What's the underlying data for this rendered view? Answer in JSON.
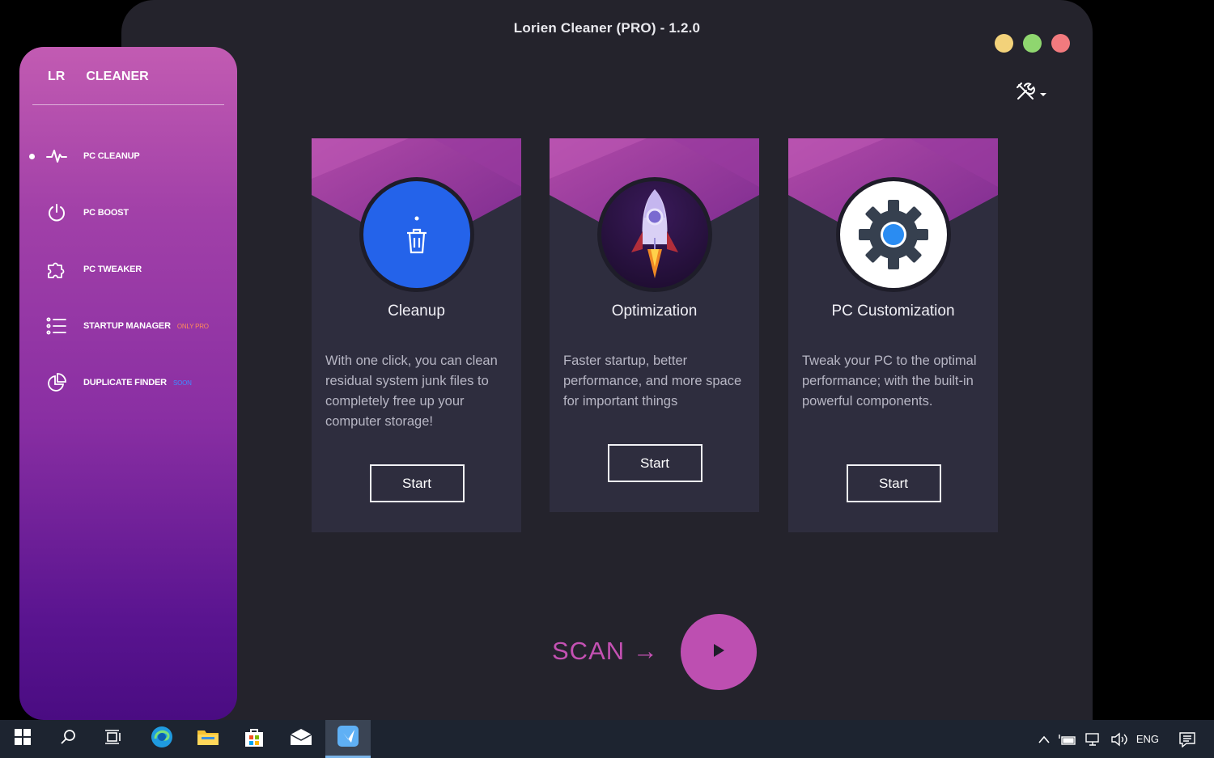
{
  "window": {
    "title": "Lorien Cleaner (PRO) - 1.2.0"
  },
  "sidebar": {
    "brand_short": "LR",
    "brand_name": "CLEANER",
    "items": [
      {
        "label": "PC CLEANUP",
        "icon": "pulse-icon",
        "active": true,
        "tag": ""
      },
      {
        "label": "PC BOOST",
        "icon": "power-icon",
        "active": false,
        "tag": ""
      },
      {
        "label": "PC TWEAKER",
        "icon": "puzzle-icon",
        "active": false,
        "tag": ""
      },
      {
        "label": "STARTUP MANAGER",
        "icon": "list-icon",
        "active": false,
        "tag": "ONLY PRO"
      },
      {
        "label": "DUPLICATE FINDER",
        "icon": "pie-chart-icon",
        "active": false,
        "tag": "SOON"
      }
    ]
  },
  "cards": [
    {
      "title": "Cleanup",
      "description": "With one click, you can clean residual system junk files to completely free up your computer storage!",
      "button": "Start",
      "icon": "trash-icon"
    },
    {
      "title": "Optimization",
      "description": "Faster startup, better performance, and more space for important things",
      "button": "Start",
      "icon": "rocket-icon"
    },
    {
      "title": "PC Customization",
      "description": "Tweak your PC to the optimal performance; with the built-in powerful components.",
      "button": "Start",
      "icon": "gear-icon"
    }
  ],
  "scan": {
    "label": "SCAN →"
  },
  "taskbar": {
    "language": "ENG"
  },
  "colors": {
    "accent": "#c451b3",
    "window_bg": "#24232c",
    "card_bg": "#2e2d3e"
  }
}
